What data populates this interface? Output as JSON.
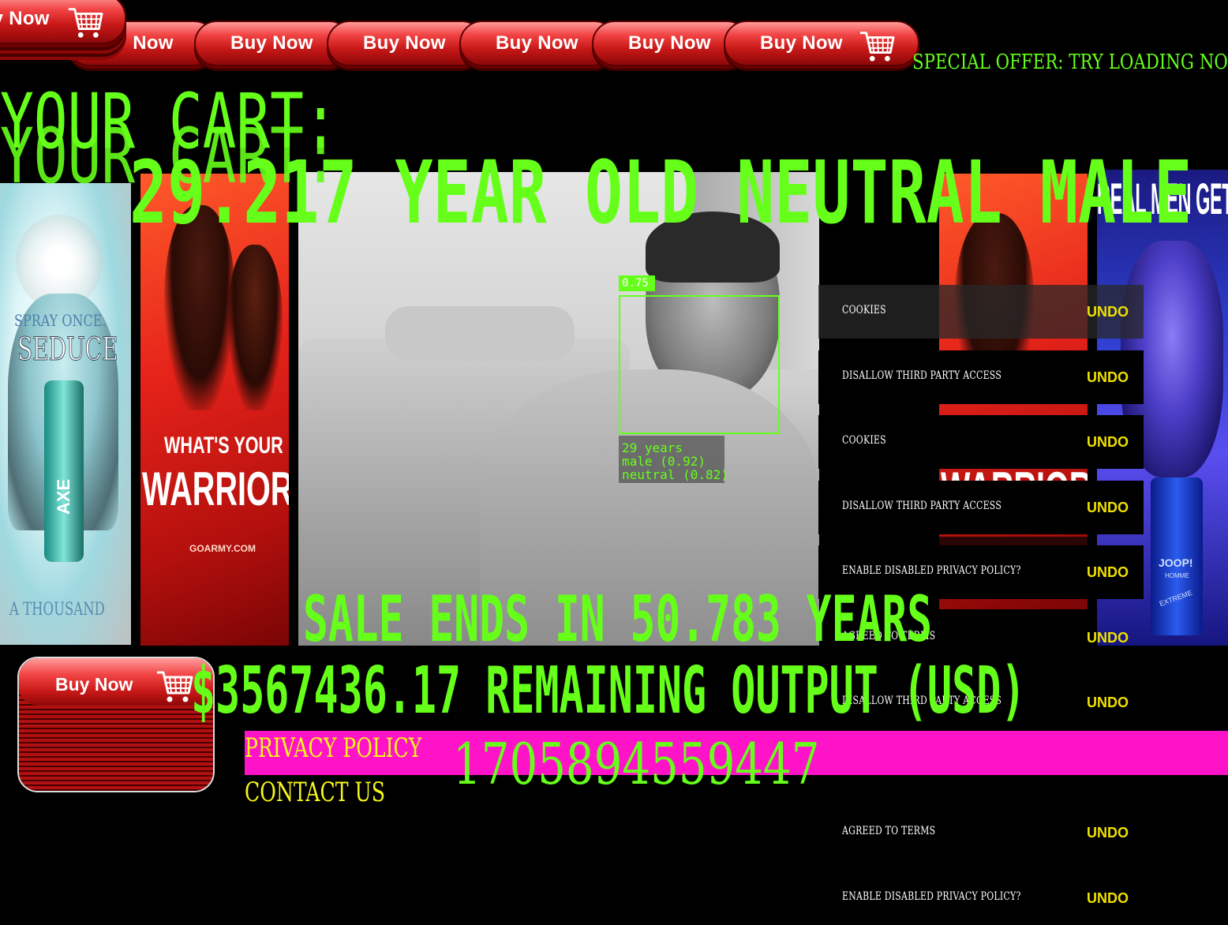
{
  "header": {
    "buy_label": "Buy Now",
    "special_offer": "SPECIAL OFFER: TRY LOADING NOW!"
  },
  "cart": {
    "title": "YOUR CART:",
    "subject": "29.217 YEAR OLD NEUTRAL MALE",
    "sale": "SALE ENDS IN 50.783 YEARS",
    "remaining": "$3567436.17 REMAINING OUTPUT (USD)",
    "counter": "1705894559447"
  },
  "footer": {
    "privacy": "PRIVACY POLICY",
    "contact": "CONTACT US"
  },
  "ads": {
    "axe": {
      "line1": "SPRAY ONCE.",
      "line2": "SEDUCE",
      "line3": "A THOUSAND",
      "brand": "AXE"
    },
    "army": {
      "line1": "WHAT'S YOUR",
      "line2": "WARRIOR?",
      "url": "GOARMY.COM"
    },
    "joop": {
      "headline": "REAL MEN GET MO",
      "brand": "JOOP!",
      "sub": "HOMME",
      "tag": "EXTREME"
    },
    "army2": {
      "line2": "WARRIOR?"
    }
  },
  "face_detection": {
    "confidence": "0.75",
    "age": "29 years",
    "gender": "male (0.92)",
    "expression": "neutral (0.82)"
  },
  "cookie_rows": [
    {
      "text": "COOKIES",
      "undo": "UNDO"
    },
    {
      "text": "DISALLOW THIRD PARTY ACCESS",
      "undo": "UNDO"
    },
    {
      "text": "COOKIES",
      "undo": "UNDO"
    },
    {
      "text": "DISALLOW THIRD PARTY ACCESS",
      "undo": "UNDO"
    },
    {
      "text": "ENABLE DISABLED PRIVACY POLICY?",
      "undo": "UNDO"
    },
    {
      "text": "AGREED TO TERMS",
      "undo": "UNDO"
    },
    {
      "text": "DISALLOW THIRD PARTY ACCESS",
      "undo": "UNDO"
    },
    {
      "text": "AGREED TO TERMS",
      "undo": "UNDO"
    },
    {
      "text": "ENABLE DISABLED PRIVACY POLICY?",
      "undo": "UNDO"
    }
  ],
  "colors": {
    "neon_green": "#66ff1a",
    "alert_yellow": "#f6f61a",
    "magenta_bar": "#ff13c8",
    "button_red": "#e02020"
  }
}
